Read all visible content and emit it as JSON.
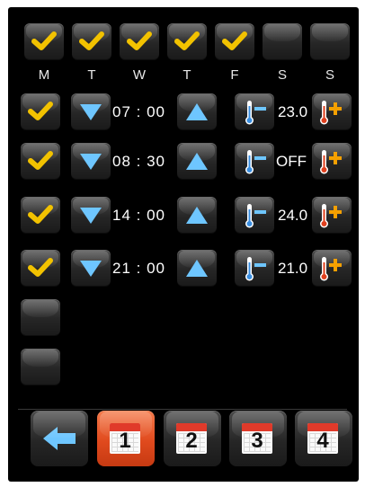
{
  "days": [
    {
      "label": "M",
      "checked": true
    },
    {
      "label": "T",
      "checked": true
    },
    {
      "label": "W",
      "checked": true
    },
    {
      "label": "T",
      "checked": true
    },
    {
      "label": "F",
      "checked": true
    },
    {
      "label": "S",
      "checked": false
    },
    {
      "label": "S",
      "checked": false
    }
  ],
  "schedule": [
    {
      "enabled": true,
      "time": "07 : 00",
      "temp": "23.0"
    },
    {
      "enabled": true,
      "time": "08 : 30",
      "temp": "OFF"
    },
    {
      "enabled": true,
      "time": "14 : 00",
      "temp": "24.0"
    },
    {
      "enabled": true,
      "time": "21 : 00",
      "temp": "21.0"
    },
    {
      "enabled": false
    },
    {
      "enabled": false
    }
  ],
  "programs": [
    {
      "label": "1",
      "active": true
    },
    {
      "label": "2",
      "active": false
    },
    {
      "label": "3",
      "active": false
    },
    {
      "label": "4",
      "active": false
    }
  ],
  "colors": {
    "check": "#f2c200",
    "arrow": "#6ec6ff",
    "thermo_plus": "#f5a000"
  }
}
